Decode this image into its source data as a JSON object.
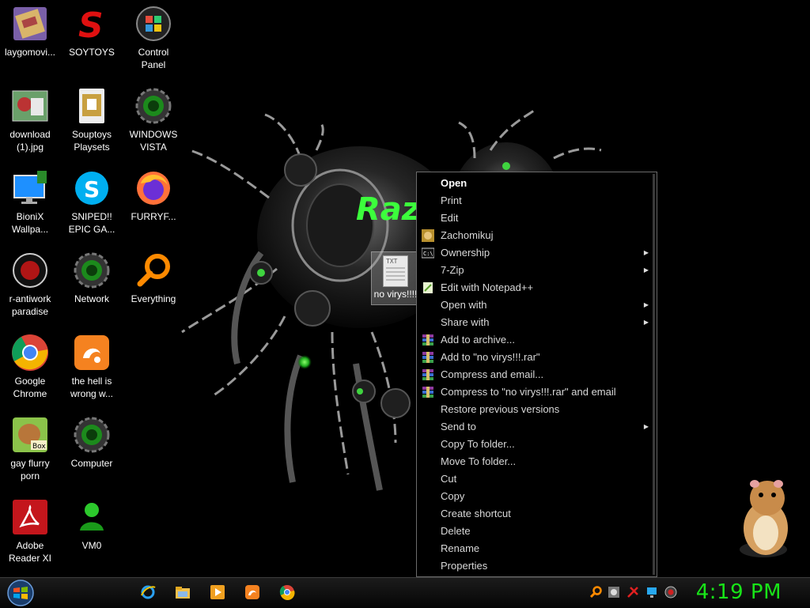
{
  "desktop_icons": [
    {
      "label": "laygomovi..."
    },
    {
      "label": "SOYTOYS"
    },
    {
      "label": "Control Panel"
    },
    {
      "label": "download (1).jpg"
    },
    {
      "label": "Souptoys Playsets"
    },
    {
      "label": "WINDOWS VISTA"
    },
    {
      "label": "BioniX Wallpa..."
    },
    {
      "label": "SNIPED!! EPIC GA..."
    },
    {
      "label": "FURRYF..."
    },
    {
      "label": "r-antiwork paradise"
    },
    {
      "label": "Network"
    },
    {
      "label": "Everything"
    },
    {
      "label": "Google Chrome"
    },
    {
      "label": "the hell is wrong w..."
    },
    {
      "label": "gay flurry porn"
    },
    {
      "label": "Computer"
    },
    {
      "label": "Adobe Reader XI"
    },
    {
      "label": "VM0"
    }
  ],
  "wallpaper": {
    "text": "Raz"
  },
  "selected_file": {
    "label": "no virys!!!!",
    "doc_text": "TXT"
  },
  "context_menu": {
    "items": [
      {
        "label": "Open"
      },
      {
        "label": "Print"
      },
      {
        "label": "Edit"
      },
      {
        "label": "Zachomikuj"
      },
      {
        "label": "Ownership"
      },
      {
        "label": "7-Zip"
      },
      {
        "label": "Edit with Notepad++"
      },
      {
        "label": "Open with"
      },
      {
        "label": "Share with"
      },
      {
        "label": "Add to archive..."
      },
      {
        "label": "Add to \"no virys!!!.rar\""
      },
      {
        "label": "Compress and email..."
      },
      {
        "label": "Compress to \"no virys!!!.rar\" and email"
      },
      {
        "label": "Restore previous versions"
      },
      {
        "label": "Send to"
      },
      {
        "label": "Copy To folder..."
      },
      {
        "label": "Move To folder..."
      },
      {
        "label": "Cut"
      },
      {
        "label": "Copy"
      },
      {
        "label": "Create shortcut"
      },
      {
        "label": "Delete"
      },
      {
        "label": "Rename"
      },
      {
        "label": "Properties"
      }
    ]
  },
  "taskbar": {
    "pinned": [
      "internet-explorer",
      "explorer",
      "media-player",
      "uc-browser",
      "chrome"
    ],
    "clock": "4:19 PM"
  },
  "colors": {
    "clock": "#18e418",
    "accent_green": "#2bff2b"
  }
}
